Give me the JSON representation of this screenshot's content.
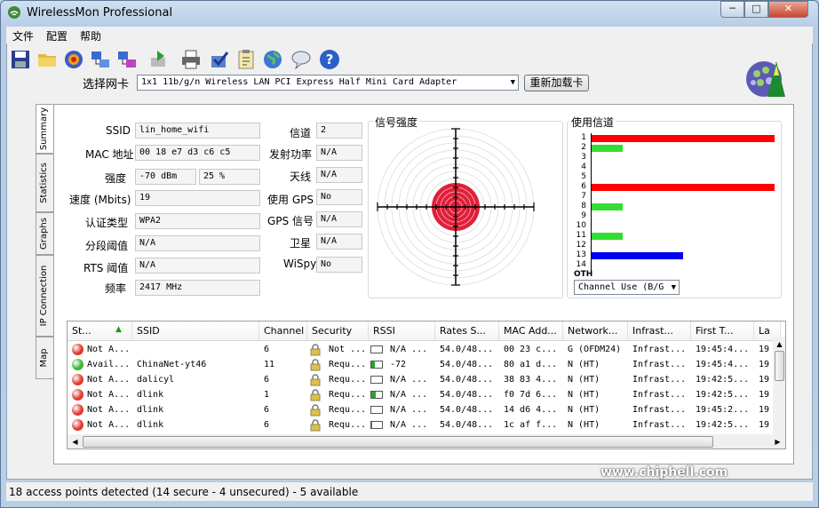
{
  "window": {
    "title": "WirelessMon Professional",
    "minimize": "─",
    "maximize": "□",
    "close": "✕"
  },
  "menu": [
    "文件",
    "配置",
    "帮助"
  ],
  "toolbar_icons": [
    "save-icon",
    "open-folder-icon",
    "record-icon",
    "network-icon",
    "network-config-icon",
    "export-icon",
    "print-icon",
    "check-icon",
    "clipboard-icon",
    "globe-icon",
    "feedback-icon",
    "help-icon"
  ],
  "adapter": {
    "label": "选择网卡",
    "value": "1x1 11b/g/n Wireless LAN PCI Express Half Mini Card Adapter",
    "reload": "重新加载卡"
  },
  "tabs": [
    "Summary",
    "Statistics",
    "Graphs",
    "IP Connection",
    "Map"
  ],
  "summary": {
    "ssid_label": "SSID",
    "ssid": "lin_home_wifi",
    "mac_label": "MAC 地址",
    "mac": "00 18 e7 d3 c6 c5",
    "strength_label": "强度",
    "strength_dbm": "-70 dBm",
    "strength_pct": "25 %",
    "speed_label": "速度 (Mbits)",
    "speed": "19",
    "auth_label": "认证类型",
    "auth": "WPA2",
    "frag_label": "分段阈值",
    "frag": "N/A",
    "rts_label": "RTS 阈值",
    "rts": "N/A",
    "freq_label": "频率",
    "freq": "2417 MHz",
    "channel_label": "信道",
    "channel": "2",
    "txpower_label": "发射功率",
    "txpower": "N/A",
    "antenna_label": "天线",
    "antenna": "N/A",
    "gps_label": "使用 GPS",
    "gps": "No",
    "gps_signal_label": "GPS 信号",
    "gps_signal": "N/A",
    "satellite_label": "卫星",
    "satellite": "N/A",
    "wispy_label": "WiSpy",
    "wispy": "No"
  },
  "signal_title": "信号强度",
  "channel_use": {
    "title": "使用信道",
    "channels": [
      "1",
      "2",
      "3",
      "4",
      "5",
      "6",
      "7",
      "8",
      "9",
      "10",
      "11",
      "12",
      "13",
      "14",
      "OTH"
    ],
    "bars": [
      {
        "ch": 1,
        "color": "#ff0000",
        "len": 1.0
      },
      {
        "ch": 2,
        "color": "#33dd33",
        "len": 0.17
      },
      {
        "ch": 6,
        "color": "#ff0000",
        "len": 1.0
      },
      {
        "ch": 8,
        "color": "#33dd33",
        "len": 0.17
      },
      {
        "ch": 11,
        "color": "#33dd33",
        "len": 0.17
      },
      {
        "ch": 13,
        "color": "#0000ee",
        "len": 0.5
      }
    ],
    "mode": "Channel Use (B/G"
  },
  "table": {
    "columns": [
      "St...",
      "SSID",
      "Channel",
      "Security",
      "RSSI",
      "Rates S...",
      "MAC Add...",
      "Network...",
      "Infrast...",
      "First T...",
      "La"
    ],
    "rows": [
      {
        "status": "Not A...",
        "color": "#e03a2e",
        "ssid": "",
        "channel": "6",
        "security": "Not ...",
        "rssi": "N/A ...",
        "rssi_level": 0,
        "rates": "54.0/48...",
        "mac": "00 23 c...",
        "network": "G (OFDM24)",
        "infra": "Infrast...",
        "first": "19:45:4...",
        "last": "19"
      },
      {
        "status": "Avail...",
        "color": "#3ab534",
        "ssid": "ChinaNet-yt46",
        "channel": "11",
        "security": "Requ...",
        "rssi": "-72",
        "rssi_level": 0.3,
        "rates": "54.0/48...",
        "mac": "80 a1 d...",
        "network": "N (HT)",
        "infra": "Infrast...",
        "first": "19:45:4...",
        "last": "19"
      },
      {
        "status": "Not A...",
        "color": "#e03a2e",
        "ssid": "dalicyl",
        "channel": "6",
        "security": "Requ...",
        "rssi": "N/A ...",
        "rssi_level": 0,
        "rates": "54.0/48...",
        "mac": "38 83 4...",
        "network": "N (HT)",
        "infra": "Infrast...",
        "first": "19:42:5...",
        "last": "19"
      },
      {
        "status": "Not A...",
        "color": "#e03a2e",
        "ssid": "dlink",
        "channel": "1",
        "security": "Requ...",
        "rssi": "N/A ...",
        "rssi_level": 0.4,
        "rates": "54.0/48...",
        "mac": "f0 7d 6...",
        "network": "N (HT)",
        "infra": "Infrast...",
        "first": "19:42:5...",
        "last": "19"
      },
      {
        "status": "Not A...",
        "color": "#e03a2e",
        "ssid": "dlink",
        "channel": "6",
        "security": "Requ...",
        "rssi": "N/A ...",
        "rssi_level": 0,
        "rates": "54.0/48...",
        "mac": "14 d6 4...",
        "network": "N (HT)",
        "infra": "Infrast...",
        "first": "19:45:2...",
        "last": "19"
      },
      {
        "status": "Not A...",
        "color": "#e03a2e",
        "ssid": "dlink",
        "channel": "6",
        "security": "Requ...",
        "rssi": "N/A ...",
        "rssi_level": 0.1,
        "rates": "54.0/48...",
        "mac": "1c af f...",
        "network": "N (HT)",
        "infra": "Infrast...",
        "first": "19:42:5...",
        "last": "19"
      }
    ]
  },
  "status_bar": "18 access points detected (14 secure - 4 unsecured) - 5 available",
  "watermark": "www.chiphell.com"
}
